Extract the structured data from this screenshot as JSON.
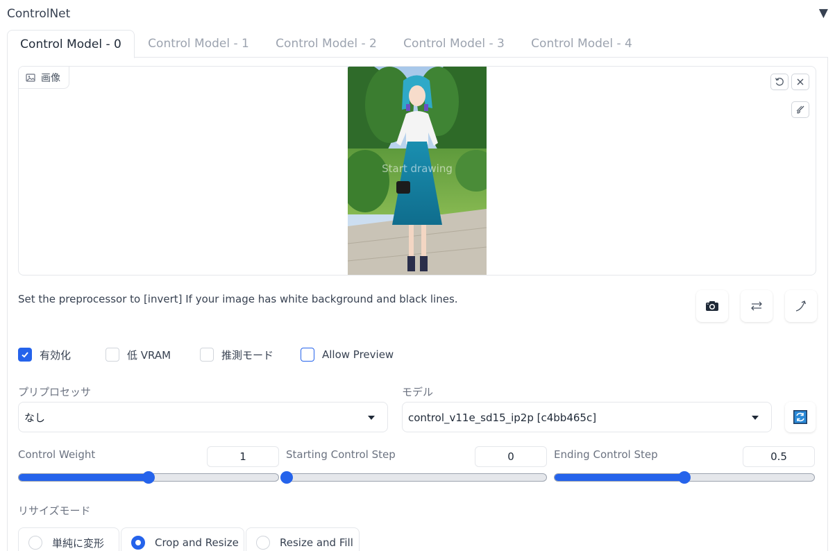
{
  "header": {
    "title": "ControlNet",
    "toggle_glyph": "▼"
  },
  "tabs": [
    {
      "label": "Control Model - 0",
      "active": true
    },
    {
      "label": "Control Model - 1",
      "active": false
    },
    {
      "label": "Control Model - 2",
      "active": false
    },
    {
      "label": "Control Model - 3",
      "active": false
    },
    {
      "label": "Control Model - 4",
      "active": false
    }
  ],
  "image_panel": {
    "label": "画像",
    "label_icon": "image-icon",
    "overlay_text": "Start drawing",
    "buttons": [
      "undo-icon",
      "close-icon",
      "brush-icon"
    ]
  },
  "info_text": "Set the preprocessor to [invert] If your image has white background and black lines.",
  "tools": [
    "camera-icon",
    "swap-icon",
    "curve-arrow-icon"
  ],
  "checkboxes": [
    {
      "label": "有効化",
      "checked": true
    },
    {
      "label": "低 VRAM",
      "checked": false
    },
    {
      "label": "推測モード",
      "checked": false
    },
    {
      "label": "Allow Preview",
      "checked": false
    }
  ],
  "preprocessor": {
    "label": "プリプロセッサ",
    "value": "なし"
  },
  "model": {
    "label": "モデル",
    "value": "control_v11e_sd15_ip2p [c4bb465c]"
  },
  "sliders": [
    {
      "label": "Control Weight",
      "value": "1",
      "fraction": 0.5
    },
    {
      "label": "Starting Control Step",
      "value": "0",
      "fraction": 0.0
    },
    {
      "label": "Ending Control Step",
      "value": "0.5",
      "fraction": 0.5
    }
  ],
  "resize_mode": {
    "label": "リサイズモード",
    "options": [
      {
        "label": "単純に変形",
        "selected": false
      },
      {
        "label": "Crop and Resize",
        "selected": true
      },
      {
        "label": "Resize and Fill",
        "selected": false
      }
    ]
  },
  "colors": {
    "accent": "#2563eb",
    "border": "#e5e7eb",
    "muted_text": "#9ca3af"
  }
}
